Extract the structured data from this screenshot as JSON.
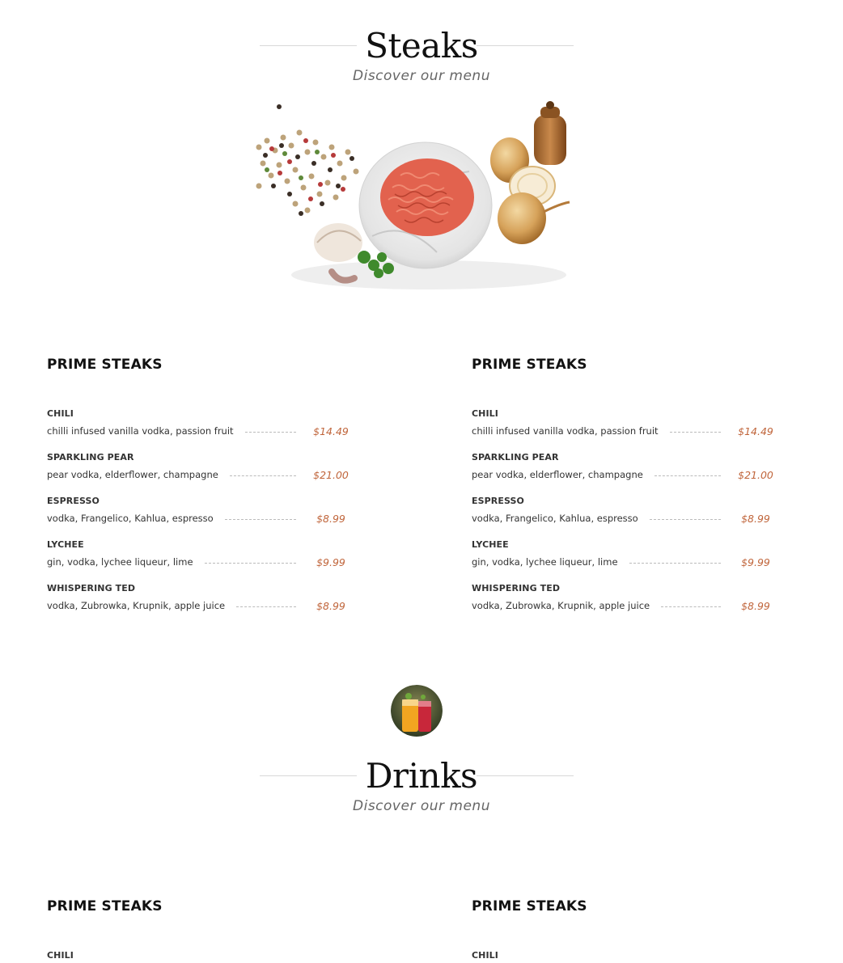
{
  "sections": [
    {
      "title": "Steaks",
      "subtitle": "Discover our menu"
    },
    {
      "title": "Drinks",
      "subtitle": "Discover our menu"
    }
  ],
  "menu_columns": [
    {
      "heading": "PRIME STEAKS",
      "items": [
        {
          "name": "CHILI",
          "desc": "chilli infused vanilla vodka, passion fruit",
          "price": "$14.49"
        },
        {
          "name": "SPARKLING PEAR",
          "desc": "pear vodka, elderflower, champagne",
          "price": "$21.00"
        },
        {
          "name": "ESPRESSO",
          "desc": "vodka, Frangelico, Kahlua, espresso",
          "price": "$8.99"
        },
        {
          "name": "LYCHEE",
          "desc": "gin, vodka, lychee liqueur, lime",
          "price": "$9.99"
        },
        {
          "name": "WHISPERING TED",
          "desc": "vodka, Zubrowka, Krupnik, apple juice",
          "price": "$8.99"
        }
      ]
    },
    {
      "heading": "PRIME STEAKS",
      "items": [
        {
          "name": "CHILI",
          "desc": "chilli infused vanilla vodka, passion fruit",
          "price": "$14.49"
        },
        {
          "name": "SPARKLING PEAR",
          "desc": "pear vodka, elderflower, champagne",
          "price": "$21.00"
        },
        {
          "name": "ESPRESSO",
          "desc": "vodka, Frangelico, Kahlua, espresso",
          "price": "$8.99"
        },
        {
          "name": "LYCHEE",
          "desc": "gin, vodka, lychee liqueur, lime",
          "price": "$9.99"
        },
        {
          "name": "WHISPERING TED",
          "desc": "vodka, Zubrowka, Krupnik, apple juice",
          "price": "$8.99"
        }
      ]
    }
  ],
  "drinks_columns": [
    {
      "heading": "PRIME STEAKS",
      "items": [
        {
          "name": "CHILI"
        }
      ]
    },
    {
      "heading": "PRIME STEAKS",
      "items": [
        {
          "name": "CHILI"
        }
      ]
    }
  ],
  "colors": {
    "price": "#c0653b",
    "rule": "#d8d8d8",
    "heading": "#111111"
  },
  "images": {
    "hero": "ingredients-photo",
    "drinks_icon": "cocktail-glasses-photo"
  }
}
